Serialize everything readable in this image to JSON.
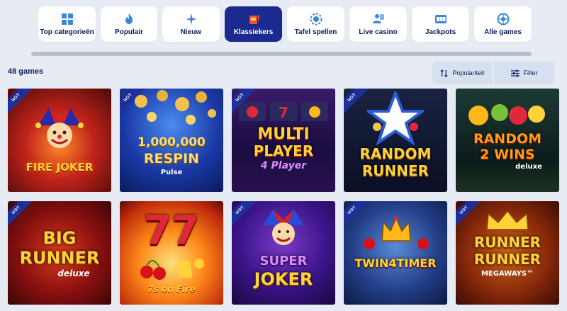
{
  "tabs": [
    {
      "label": "Top categorieën",
      "icon": "grid-icon"
    },
    {
      "label": "Populair",
      "icon": "flame-icon"
    },
    {
      "label": "Nieuw",
      "icon": "sparkle-icon"
    },
    {
      "label": "Klassiekers",
      "icon": "slot-machine-icon",
      "active": true
    },
    {
      "label": "Tafel spellen",
      "icon": "chip-icon"
    },
    {
      "label": "Live casino",
      "icon": "dealer-icon"
    },
    {
      "label": "Jackpots",
      "icon": "jackpot-icon"
    },
    {
      "label": "Alle games",
      "icon": "wheel-icon"
    }
  ],
  "games_count": "48 games",
  "controls": {
    "sort_label": "Populariteit",
    "sort_icon": "sort-arrows-icon",
    "filter_label": "Filter",
    "filter_icon": "sliders-icon"
  },
  "games": [
    {
      "title": "Fire Joker",
      "badge": "HOT"
    },
    {
      "title": "1.000.000 coins Respin",
      "title_lines": [
        "1,000,000",
        "RESPIN"
      ],
      "extra": "Pulse",
      "badge": "HOT"
    },
    {
      "title": "Multi Player 4 Player",
      "title_lines": [
        "MULTI",
        "PLAYER"
      ],
      "extra": "4 Player",
      "badge": "HOT"
    },
    {
      "title": "Random Runner",
      "title_lines": [
        "RANDOM",
        "RUNNER"
      ],
      "badge": "HOT"
    },
    {
      "title": "Random 2 Wins deluxe",
      "title_lines": [
        "RANDOM",
        "2 WINS"
      ],
      "extra": "deluxe",
      "badge": ""
    },
    {
      "title": "Big Runner deluxe",
      "title_lines": [
        "BIG",
        "RUNNER"
      ],
      "extra": "deluxe",
      "badge": "HOT"
    },
    {
      "title": "7s on Fire",
      "title_lines": [
        "77"
      ],
      "extra": "7s on Fire",
      "badge": ""
    },
    {
      "title": "Super Joker",
      "title_lines": [
        "SUPER",
        "JOKER"
      ],
      "badge": "HOT"
    },
    {
      "title": "Twin 4 Timer",
      "title_lines": [
        "TWIN4TIMER"
      ],
      "badge": "HOT"
    },
    {
      "title": "Runner Runner Megaways",
      "title_lines": [
        "RUNNER",
        "RUNNER"
      ],
      "extra": "MEGAWAYS™",
      "badge": "HOT"
    }
  ],
  "colors": {
    "background": "#e7ecf4",
    "active_tab": "#1a2a8f",
    "navy_text": "#0c1d5c",
    "hot_ribbon": "#1e2f9c"
  }
}
